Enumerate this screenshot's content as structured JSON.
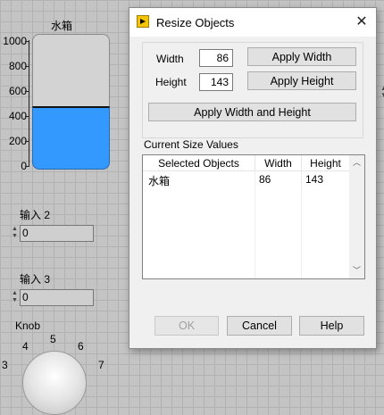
{
  "front_panel": {
    "tank": {
      "title": "水箱",
      "scale": [
        "1000",
        "800",
        "600",
        "400",
        "200",
        "0"
      ],
      "level": 400,
      "fill_color": "#3399ff"
    },
    "input2": {
      "label": "输入 2",
      "value": "0"
    },
    "input3": {
      "label": "输入 3",
      "value": "0"
    },
    "knob": {
      "title": "Knob",
      "scale": [
        "3",
        "4",
        "5",
        "6",
        "7"
      ]
    }
  },
  "dialog": {
    "title": "Resize Objects",
    "width_label": "Width",
    "width_value": "86",
    "height_label": "Height",
    "height_value": "143",
    "apply_width": "Apply Width",
    "apply_height": "Apply Height",
    "apply_both": "Apply Width and Height",
    "section_label": "Current Size Values",
    "table": {
      "headers": [
        "Selected Objects",
        "Width",
        "Height"
      ],
      "rows": [
        [
          "水箱",
          "86",
          "143"
        ]
      ]
    },
    "buttons": {
      "ok": "OK",
      "cancel": "Cancel",
      "help": "Help"
    }
  }
}
